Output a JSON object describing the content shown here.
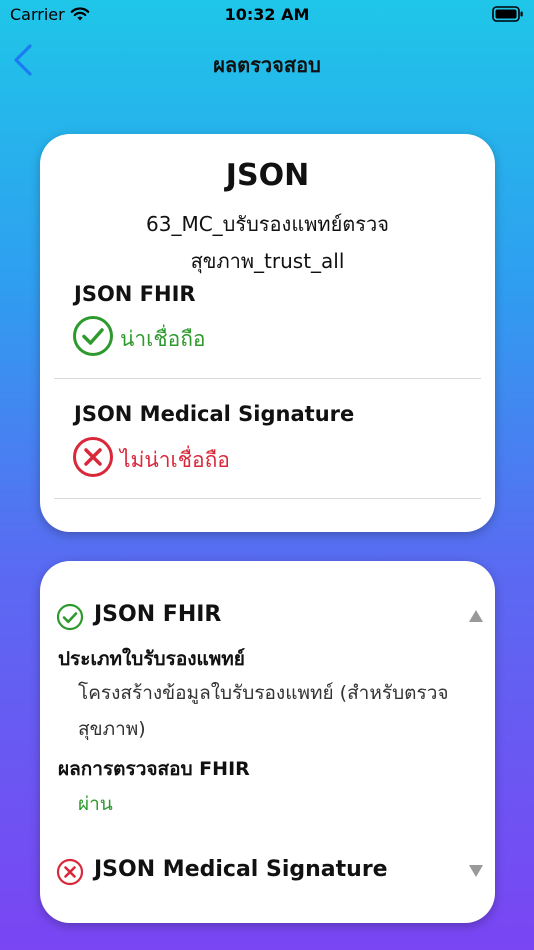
{
  "status_bar": {
    "carrier": "Carrier",
    "time": "10:32 AM"
  },
  "nav": {
    "title": "ผลตรวจสอบ",
    "back_icon": "chevron-left-icon",
    "accent_color": "#1a7cf0"
  },
  "summary": {
    "title": "JSON",
    "filename": "63_MC_บรับรองแพทย์ตรวจสุขภาพ_trust_all",
    "sections": [
      {
        "heading": "JSON FHIR",
        "status": "น่าเชื่อถือ",
        "icon": "check-circle-icon",
        "color": "#2e9a2e"
      },
      {
        "heading": "JSON Medical Signature",
        "status": "ไม่น่าเชื่อถือ",
        "icon": "x-circle-icon",
        "color": "#d9283a"
      }
    ]
  },
  "detail": {
    "fhir": {
      "title": "JSON FHIR",
      "icon": "check-circle-icon",
      "expanded": true,
      "chevron": "triangle-up-icon",
      "cert_type_label": "ประเภทใบรับรองแพทย์",
      "cert_type_value": "โครงสร้างข้อมูลใบรับรองแพทย์ (สำหรับตรวจสุขภาพ)",
      "result_label": "ผลการตรวจสอบ FHIR",
      "result_value": "ผ่าน"
    },
    "signature": {
      "title": "JSON Medical Signature",
      "icon": "x-circle-icon",
      "expanded": false,
      "chevron": "triangle-down-icon"
    }
  }
}
